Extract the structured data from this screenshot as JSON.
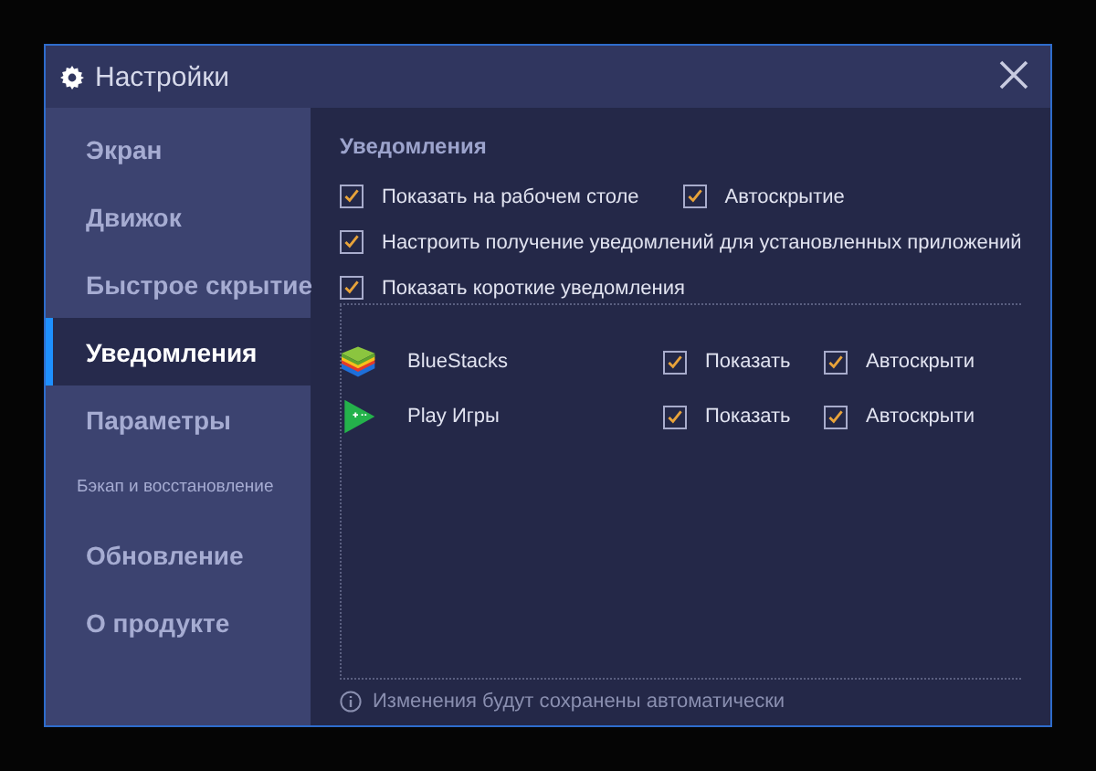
{
  "window": {
    "title": "Настройки"
  },
  "sidebar": {
    "items": [
      {
        "label": "Экран",
        "selected": false,
        "kind": "large"
      },
      {
        "label": "Движок",
        "selected": false,
        "kind": "large"
      },
      {
        "label": "Быстрое скрытие",
        "selected": false,
        "kind": "large"
      },
      {
        "label": "Уведомления",
        "selected": true,
        "kind": "large"
      },
      {
        "label": "Параметры",
        "selected": false,
        "kind": "large"
      },
      {
        "label": "Бэкап и восстановление",
        "selected": false,
        "kind": "small"
      },
      {
        "label": "Обновление",
        "selected": false,
        "kind": "large"
      },
      {
        "label": "О продукте",
        "selected": false,
        "kind": "large"
      }
    ]
  },
  "section_title": "Уведомления",
  "options": [
    [
      {
        "label": "Показать на рабочем столе",
        "checked": true
      },
      {
        "label": "Автоскрытие",
        "checked": true
      }
    ],
    [
      {
        "label": "Настроить получение уведомлений для установленных приложений",
        "checked": true
      }
    ],
    [
      {
        "label": "Показать короткие уведомления",
        "checked": true
      }
    ]
  ],
  "apps": [
    {
      "name": "BlueStacks",
      "kind": "bluestacks",
      "show": {
        "label": "Показать",
        "checked": true
      },
      "autohide": {
        "label": "Автоскрыти",
        "checked": true
      }
    },
    {
      "name": "Play Игры",
      "kind": "playgames",
      "show": {
        "label": "Показать",
        "checked": true
      },
      "autohide": {
        "label": "Автоскрыти",
        "checked": true
      }
    }
  ],
  "footer_note": "Изменения будут сохранены автоматически"
}
